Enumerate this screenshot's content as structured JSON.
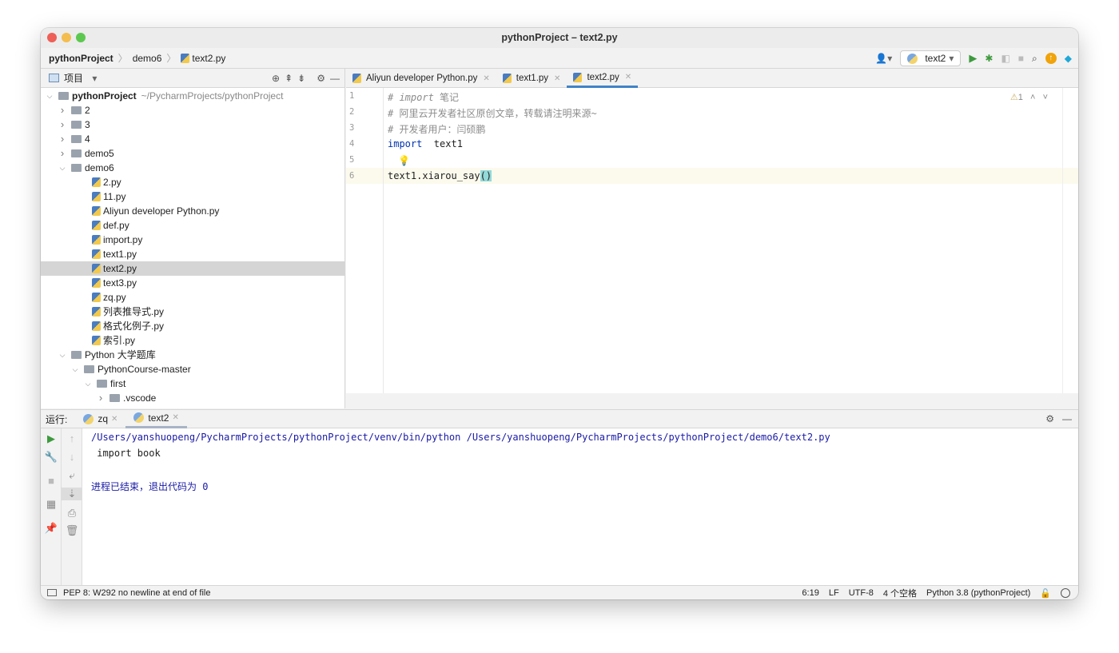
{
  "window": {
    "title": "pythonProject – text2.py"
  },
  "breadcrumb": [
    "pythonProject",
    "demo6",
    "text2.py"
  ],
  "toolbar": {
    "run_config": "text2"
  },
  "project_panel": {
    "title": "项目"
  },
  "tree": [
    {
      "label": "pythonProject",
      "path": "~/PycharmProjects/pythonProject",
      "type": "folder",
      "depth": 0,
      "expanded": true
    },
    {
      "label": "2",
      "type": "folder",
      "depth": 1,
      "expanded": false
    },
    {
      "label": "3",
      "type": "folder",
      "depth": 1,
      "expanded": false
    },
    {
      "label": "4",
      "type": "folder",
      "depth": 1,
      "expanded": false
    },
    {
      "label": "demo5",
      "type": "folder",
      "depth": 1,
      "expanded": false
    },
    {
      "label": "demo6",
      "type": "folder",
      "depth": 1,
      "expanded": true
    },
    {
      "label": "2.py",
      "type": "file",
      "depth": 2
    },
    {
      "label": "11.py",
      "type": "file",
      "depth": 2
    },
    {
      "label": "Aliyun developer Python.py",
      "type": "file",
      "depth": 2
    },
    {
      "label": "def.py",
      "type": "file",
      "depth": 2
    },
    {
      "label": "import.py",
      "type": "file",
      "depth": 2
    },
    {
      "label": "text1.py",
      "type": "file",
      "depth": 2
    },
    {
      "label": "text2.py",
      "type": "file",
      "depth": 2,
      "selected": true
    },
    {
      "label": "text3.py",
      "type": "file",
      "depth": 2
    },
    {
      "label": "zq.py",
      "type": "file",
      "depth": 2
    },
    {
      "label": "列表推导式.py",
      "type": "file",
      "depth": 2
    },
    {
      "label": "格式化例子.py",
      "type": "file",
      "depth": 2
    },
    {
      "label": "索引.py",
      "type": "file",
      "depth": 2
    },
    {
      "label": "Python 大学题库",
      "type": "folder",
      "depth": 1,
      "expanded": true
    },
    {
      "label": "PythonCourse-master",
      "type": "folder",
      "depth": 2,
      "expanded": true
    },
    {
      "label": "first",
      "type": "folder",
      "depth": 3,
      "expanded": true
    },
    {
      "label": ".vscode",
      "type": "folder",
      "depth": 4,
      "expanded": false
    }
  ],
  "editor_tabs": [
    {
      "label": "Aliyun developer Python.py"
    },
    {
      "label": "text1.py"
    },
    {
      "label": "text2.py",
      "active": true
    }
  ],
  "editor": {
    "warnings": "1",
    "lines": [
      {
        "n": "1",
        "parts": [
          [
            "cmt",
            "# "
          ],
          [
            "cmti",
            "import"
          ],
          [
            "cmt",
            " 笔记"
          ]
        ]
      },
      {
        "n": "2",
        "parts": [
          [
            "cmt",
            "# 阿里云开发者社区原创文章，转载请注明来源~"
          ]
        ]
      },
      {
        "n": "3",
        "parts": [
          [
            "cmt",
            "# 开发者用户：闫硕鹏"
          ]
        ]
      },
      {
        "n": "4",
        "parts": [
          [
            "kw",
            "import"
          ],
          [
            "",
            "  text1"
          ]
        ]
      },
      {
        "n": "5",
        "parts": []
      },
      {
        "n": "6",
        "parts": [
          [
            "",
            "text1.xiarou_say"
          ],
          [
            "hl",
            "()"
          ]
        ]
      }
    ]
  },
  "run_panel": {
    "label": "运行:",
    "tabs": [
      {
        "label": "zq"
      },
      {
        "label": "text2",
        "active": true
      }
    ],
    "output": [
      "/Users/yanshuopeng/PycharmProjects/pythonProject/venv/bin/python /Users/yanshuopeng/PycharmProjects/pythonProject/demo6/text2.py",
      " import book",
      "",
      "进程已结束，退出代码为 0"
    ]
  },
  "status_bar": {
    "message": "PEP 8: W292 no newline at end of file",
    "position": "6:19",
    "line_sep": "LF",
    "encoding": "UTF-8",
    "indent": "4 个空格",
    "interpreter": "Python 3.8 (pythonProject)"
  },
  "colors": {
    "accent": "#4083c9",
    "run": "#3d9a3d",
    "console_path": "#1a1aa6",
    "keyword": "#0033b3"
  }
}
